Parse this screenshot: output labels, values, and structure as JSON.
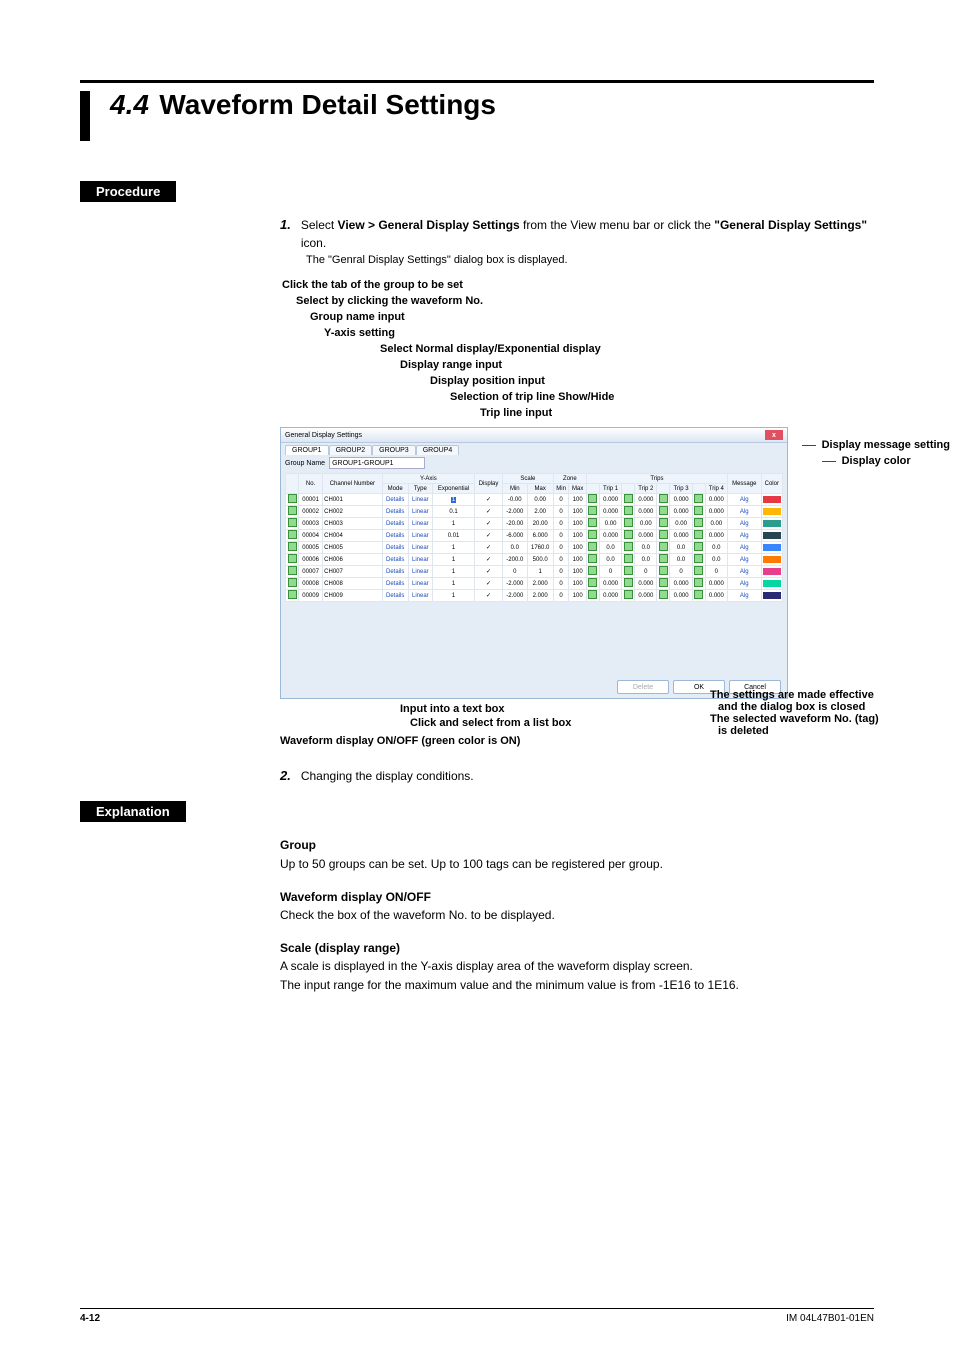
{
  "header": {
    "section_num": "4.4",
    "section_title": "Waveform Detail Settings"
  },
  "procedure": {
    "label": "Procedure",
    "step1_text_a": "Select ",
    "step1_bold_a": "View > General Display Settings",
    "step1_text_b": " from the View menu bar or click the ",
    "step1_bold_b": "\"General Display Settings\"",
    "step1_text_c": " icon.",
    "step1_note": "The \"Genral Display Settings\" dialog box is displayed.",
    "step2": "Changing the display conditions."
  },
  "callouts": {
    "c1": "Click the tab of the group to be set",
    "c2": "Select by clicking the waveform No.",
    "c3": "Group name input",
    "c4": "Y-axis setting",
    "c5": "Select Normal display/Exponential display",
    "c6": "Display range input",
    "c7": "Display position input",
    "c8": "Selection of trip line Show/Hide",
    "c9": "Trip line input",
    "r1": "Display message setting",
    "r2": "Display color",
    "b1": "Input into a text box",
    "b2": "Click and select from a list box",
    "b3": "Waveform display ON/OFF (green color is ON)",
    "br1a": "The settings are made effective",
    "br1b": "and the dialog box is closed",
    "br2a": "The selected waveform No. (tag)",
    "br2b": "is deleted"
  },
  "dialog": {
    "title": "General Display Settings",
    "close": "x",
    "tabs": [
      "GROUP1",
      "GROUP2",
      "GROUP3",
      "GROUP4"
    ],
    "gn_label": "Group Name",
    "gn_value": "GROUP1-GROUP1",
    "headers": {
      "no": "No.",
      "ch": "Channel Number",
      "yaxis": "Y-Axis",
      "mode": "Mode",
      "type": "Type",
      "exp": "Exponential",
      "disp": "Display",
      "scale": "Scale",
      "min": "Min",
      "max": "Max",
      "zone": "Zone",
      "zmin": "Min",
      "zmax": "Max",
      "trips": "Trips",
      "t1": "Trip 1",
      "t2": "Trip 2",
      "t3": "Trip 3",
      "t4": "Trip 4",
      "msg": "Message",
      "color": "Color"
    },
    "rows": [
      {
        "no": "00001",
        "ch": "CH001",
        "mode": "Details",
        "type": "Linear",
        "exp": "1",
        "disp": "✓",
        "min": "-0.00",
        "max": "0.00",
        "zmin": "0",
        "zmax": "100",
        "t1": "0.000",
        "t2": "0.000",
        "t3": "0.000",
        "t4": "0.000",
        "msg": "Alg",
        "color": "c1"
      },
      {
        "no": "00002",
        "ch": "CH002",
        "mode": "Details",
        "type": "Linear",
        "exp": "0.1",
        "disp": "✓",
        "min": "-2.000",
        "max": "2.00",
        "zmin": "0",
        "zmax": "100",
        "t1": "0.000",
        "t2": "0.000",
        "t3": "0.000",
        "t4": "0.000",
        "msg": "Alg",
        "color": "c2"
      },
      {
        "no": "00003",
        "ch": "CH003",
        "mode": "Details",
        "type": "Linear",
        "exp": "1",
        "disp": "✓",
        "min": "-20.00",
        "max": "20.00",
        "zmin": "0",
        "zmax": "100",
        "t1": "0.00",
        "t2": "0.00",
        "t3": "0.00",
        "t4": "0.00",
        "msg": "Alg",
        "color": "c3"
      },
      {
        "no": "00004",
        "ch": "CH004",
        "mode": "Details",
        "type": "Linear",
        "exp": "0.01",
        "disp": "✓",
        "min": "-6.000",
        "max": "6.000",
        "zmin": "0",
        "zmax": "100",
        "t1": "0.000",
        "t2": "0.000",
        "t3": "0.000",
        "t4": "0.000",
        "msg": "Alg",
        "color": "c4"
      },
      {
        "no": "00005",
        "ch": "CH005",
        "mode": "Details",
        "type": "Linear",
        "exp": "1",
        "disp": "✓",
        "min": "0.0",
        "max": "1760.0",
        "zmin": "0",
        "zmax": "100",
        "t1": "0.0",
        "t2": "0.0",
        "t3": "0.0",
        "t4": "0.0",
        "msg": "Alg",
        "color": "c5"
      },
      {
        "no": "00006",
        "ch": "CH006",
        "mode": "Details",
        "type": "Linear",
        "exp": "1",
        "disp": "✓",
        "min": "-200.0",
        "max": "500.0",
        "zmin": "0",
        "zmax": "100",
        "t1": "0.0",
        "t2": "0.0",
        "t3": "0.0",
        "t4": "0.0",
        "msg": "Alg",
        "color": "c6"
      },
      {
        "no": "00007",
        "ch": "CH007",
        "mode": "Details",
        "type": "Linear",
        "exp": "1",
        "disp": "✓",
        "min": "0",
        "max": "1",
        "zmin": "0",
        "zmax": "100",
        "t1": "0",
        "t2": "0",
        "t3": "0",
        "t4": "0",
        "msg": "Alg",
        "color": "c7"
      },
      {
        "no": "00008",
        "ch": "CH008",
        "mode": "Details",
        "type": "Linear",
        "exp": "1",
        "disp": "✓",
        "min": "-2.000",
        "max": "2.000",
        "zmin": "0",
        "zmax": "100",
        "t1": "0.000",
        "t2": "0.000",
        "t3": "0.000",
        "t4": "0.000",
        "msg": "Alg",
        "color": "c8"
      },
      {
        "no": "00009",
        "ch": "CH009",
        "mode": "Details",
        "type": "Linear",
        "exp": "1",
        "disp": "✓",
        "min": "-2.000",
        "max": "2.000",
        "zmin": "0",
        "zmax": "100",
        "t1": "0.000",
        "t2": "0.000",
        "t3": "0.000",
        "t4": "0.000",
        "msg": "Alg",
        "color": "c9"
      }
    ],
    "buttons": {
      "delete": "Delete",
      "ok": "OK",
      "cancel": "Cancel"
    }
  },
  "explanation": {
    "label": "Explanation",
    "group_h": "Group",
    "group_p": "Up to 50 groups can be set. Up to 100 tags can be registered per group.",
    "wf_h": "Waveform display ON/OFF",
    "wf_p": "Check the box of the waveform No. to be displayed.",
    "scale_h": "Scale (display range)",
    "scale_p1": "A scale is displayed in the Y-axis display area of the waveform display screen.",
    "scale_p2": "The input range for the maximum value and the minimum value is from -1E16 to 1E16."
  },
  "footer": {
    "page": "4-12",
    "doc": "IM 04L47B01-01EN"
  }
}
